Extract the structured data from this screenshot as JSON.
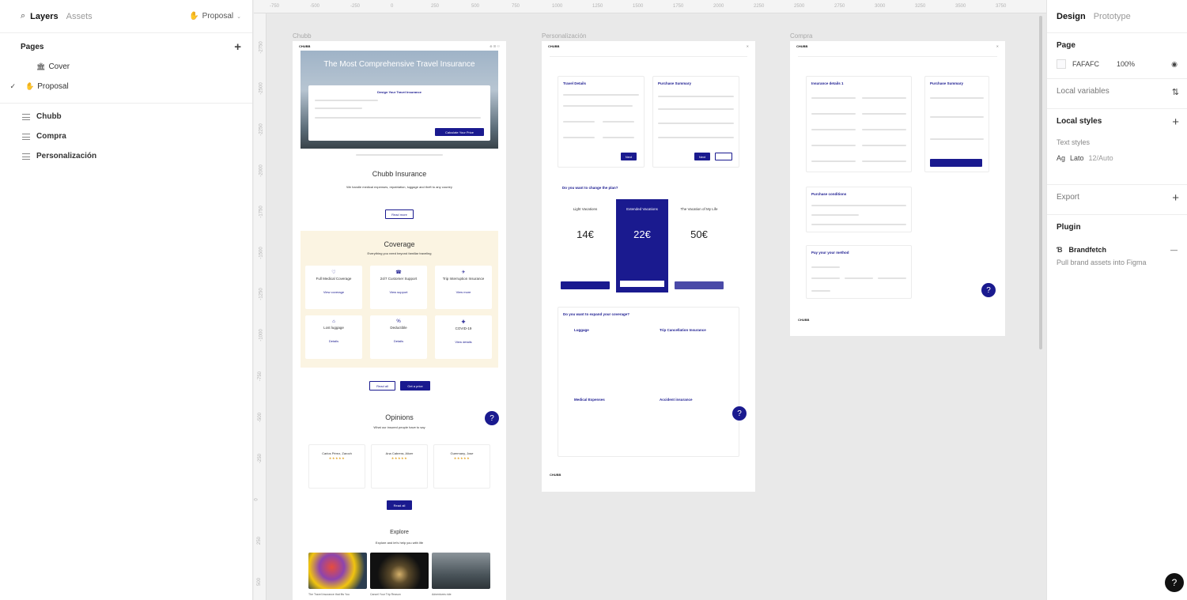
{
  "left_panel": {
    "tabs": [
      "Layers",
      "Assets"
    ],
    "current_page": "Proposal",
    "pages_heading": "Pages",
    "pages": [
      {
        "emoji": "🏛",
        "label": "Cover"
      },
      {
        "emoji": "✋",
        "label": "Proposal"
      }
    ],
    "layers": [
      "Chubb",
      "Compra",
      "Personalización"
    ]
  },
  "canvas": {
    "ruler_top": [
      "-750",
      "-500",
      "-250",
      "0",
      "250",
      "500",
      "750",
      "1000",
      "1250",
      "1500",
      "1750",
      "2000",
      "2250",
      "2500",
      "2750",
      "3000",
      "3250",
      "3500",
      "3750"
    ],
    "ruler_left": [
      "-2750",
      "-2500",
      "-2250",
      "-2000",
      "-1750",
      "-1500",
      "-1250",
      "-1000",
      "-750",
      "-500",
      "-250",
      "0",
      "250",
      "500"
    ],
    "frames": {
      "chubb": {
        "label": "Chubb",
        "logo": "CHUBB",
        "hero_title": "The Most Comprehensive Travel Insurance",
        "quote_title": "Design Your Travel Insurance",
        "quote_button": "Calculate Your Price",
        "section_title": "Chubb Insurance",
        "section_sub": "We handle medical expenses, repatriation, luggage and theft to any country",
        "section_button": "Read more",
        "coverage_title": "Coverage",
        "coverage_sub": "Everything you need beyond familiar traveling",
        "coverage_items": [
          {
            "title": "Full Medical Coverage",
            "link": "View coverage"
          },
          {
            "title": "24/7 Customer Support",
            "link": "View support"
          },
          {
            "title": "Trip Interruption Insurance",
            "link": "View more"
          },
          {
            "title": "Lost luggage",
            "link": "Details"
          },
          {
            "title": "Deductible",
            "link": "Details"
          },
          {
            "title": "COVID-19",
            "link": "View details"
          }
        ],
        "coverage_buttons": [
          "Read all",
          "Get a price"
        ],
        "opinions_title": "Opinions",
        "opinions_sub": "What our insured people have to say",
        "opinions": [
          {
            "name": "Carlos Pérez, Zaroch",
            "stars": "★★★★★"
          },
          {
            "name": "Ana Cabrera, Alicer",
            "stars": "★★★★★"
          },
          {
            "name": "Guermany, Jose",
            "stars": "★★★★★"
          }
        ],
        "opinions_button": "Read all",
        "explore_title": "Explore",
        "explore_sub": "Explore and let's help you with life",
        "explore_captions": [
          "The Travel Insurance that fits You",
          "Cancel Your Trip Reason",
          "Adventures ride"
        ]
      },
      "personalizacion": {
        "label": "Personalización",
        "logo": "CHUBB",
        "trip_details": "Travel Details",
        "purchase_summary": "Purchase Summary",
        "next_label": "Next",
        "change_plan": "Do you want to change the plan?",
        "plans": [
          {
            "name": "Light Vacations",
            "price": "14€"
          },
          {
            "name": "Extended Vacations",
            "price": "22€"
          },
          {
            "name": "The Vacation of My Life",
            "price": "50€"
          }
        ],
        "expand_title": "Do you want to expand your coverage?",
        "expand_items": [
          "Luggage",
          "Trip Cancellation Insurance",
          "Medical Expenses",
          "Accident insurance"
        ],
        "footer_logo": "CHUBB"
      },
      "compra": {
        "label": "Compra",
        "logo": "CHUBB",
        "insured_title": "Insurance details 1",
        "summary_title": "Purchase Summary",
        "conditions_title": "Purchase conditions",
        "payment_title": "Pay your your method",
        "footer_logo": "CHUBB"
      }
    }
  },
  "right_panel": {
    "tabs": [
      "Design",
      "Prototype"
    ],
    "page_title": "Page",
    "page_color": "FAFAFC",
    "page_opacity": "100%",
    "local_variables": "Local variables",
    "local_styles": "Local styles",
    "text_styles": "Text styles",
    "text_style_name": "Lato",
    "text_style_detail": "12/Auto",
    "text_style_prefix": "Ag",
    "export": "Export",
    "plugin": "Plugin",
    "plugin_name": "Brandfetch",
    "plugin_desc": "Pull brand assets into Figma"
  },
  "colors": {
    "brand_navy": "#1a1a8f",
    "coverage_bg": "#fbf4e2",
    "canvas_bg": "#e9e9e9"
  }
}
